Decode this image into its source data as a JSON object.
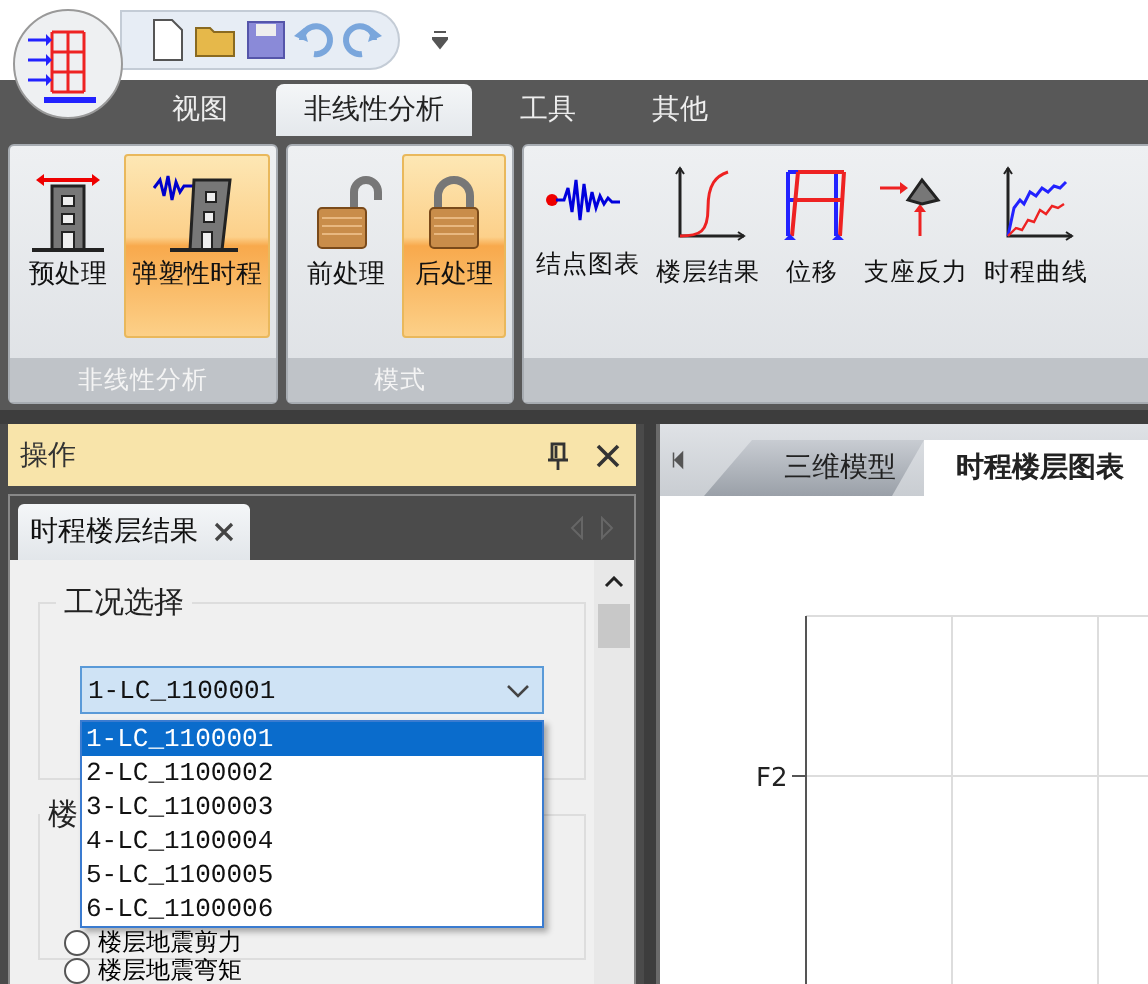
{
  "ribbon": {
    "tabs": [
      {
        "label": "视图",
        "selected": false
      },
      {
        "label": "非线性分析",
        "selected": true
      },
      {
        "label": "工具",
        "selected": false
      },
      {
        "label": "其他",
        "selected": false
      }
    ],
    "groups": [
      {
        "label": "非线性分析",
        "buttons": [
          {
            "label": "预处理",
            "selected": false
          },
          {
            "label": "弹塑性时程",
            "selected": true
          }
        ]
      },
      {
        "label": "模式",
        "buttons": [
          {
            "label": "前处理",
            "selected": false
          },
          {
            "label": "后处理",
            "selected": true
          }
        ]
      },
      {
        "buttons": [
          {
            "label": "结点图表",
            "selected": false
          },
          {
            "label": "楼层结果",
            "selected": false
          },
          {
            "label": "位移",
            "selected": false
          },
          {
            "label": "支座反力",
            "selected": false
          },
          {
            "label": "时程曲线",
            "selected": false
          }
        ]
      }
    ]
  },
  "panel": {
    "title": "操作",
    "tab": {
      "label": "时程楼层结果"
    },
    "case_group": {
      "title": "工况选择",
      "combo": {
        "value": "1-LC_1100001"
      },
      "options": [
        {
          "label": "1-LC_1100001",
          "selected": true
        },
        {
          "label": "2-LC_1100002",
          "selected": false
        },
        {
          "label": "3-LC_1100003",
          "selected": false
        },
        {
          "label": "4-LC_1100004",
          "selected": false
        },
        {
          "label": "5-LC_1100005",
          "selected": false
        },
        {
          "label": "6-LC_1100006",
          "selected": false
        }
      ]
    },
    "result_group": {
      "title": "楼",
      "radios": [
        {
          "label": "楼层地震剪力",
          "selected": false
        },
        {
          "label": "楼层地震弯矩",
          "selected": false
        }
      ]
    }
  },
  "documents": {
    "tabs": [
      {
        "label": "三维模型",
        "selected": false
      },
      {
        "label": "时程楼层图表",
        "selected": true
      }
    ],
    "chart": {
      "y_tick": "F2"
    }
  }
}
